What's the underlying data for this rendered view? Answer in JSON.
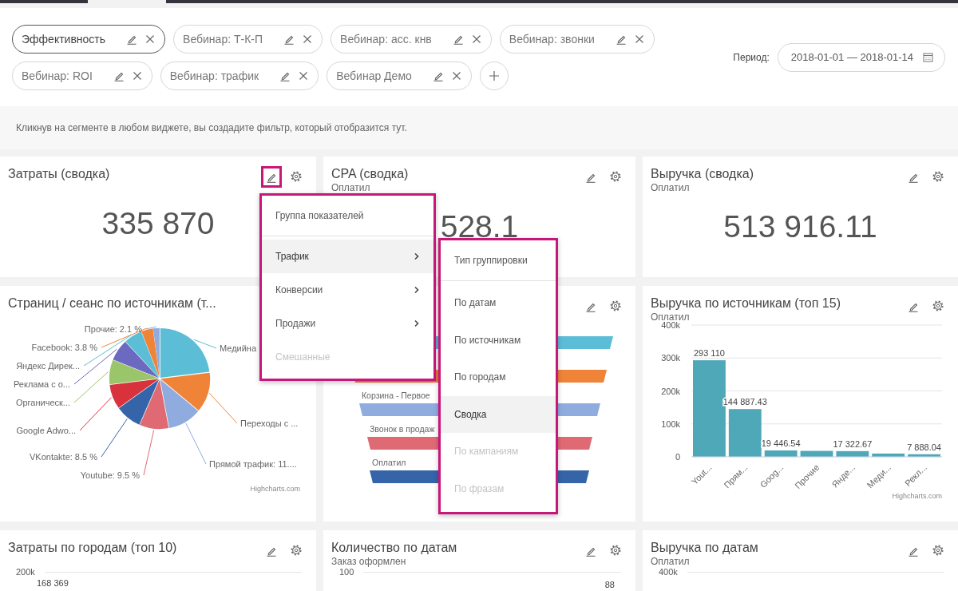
{
  "filters": {
    "chips": [
      {
        "label": "Эффективность",
        "selected": true
      },
      {
        "label": "Вебинар: Т-К-П",
        "selected": false
      },
      {
        "label": "Вебинар: асс. кнв",
        "selected": false
      },
      {
        "label": "Вебинар: звонки",
        "selected": false
      },
      {
        "label": "Вебинар: ROI",
        "selected": false
      },
      {
        "label": "Вебинар: трафик",
        "selected": false
      },
      {
        "label": "Вебинар Демо",
        "selected": false
      }
    ],
    "period_label": "Период:",
    "period_value": "2018-01-01 — 2018-01-14",
    "hint": "Кликнув на сегменте в любом виджете, вы создадите фильтр, который отобразится тут."
  },
  "widgets": [
    {
      "kind": "kpi",
      "title": "Затраты (сводка)",
      "value": "335 870",
      "edit_highlighted": true
    },
    {
      "kind": "kpi",
      "title": "CPA (сводка)",
      "subtitle": "Оплатил",
      "value": "528.1",
      "edit_highlighted": false
    },
    {
      "kind": "kpi",
      "title": "Выручка (сводка)",
      "subtitle": "Оплатил",
      "value": "513 916.11",
      "edit_highlighted": false
    },
    {
      "kind": "pie",
      "title": "Страниц / сеанс по источникам (т...",
      "credit": "Highcharts.com",
      "labels": [
        {
          "text": "Прочие: 2.1 %",
          "color": "#90acdf"
        },
        {
          "text": "Facebook: 3.8 %",
          "color": "#ef8439"
        },
        {
          "text": "Медийна",
          "color": "#5cbdd6"
        },
        {
          "text": "Яндекс Дирек...",
          "color": "#5cbdd6"
        },
        {
          "text": "Реклама с о...",
          "color": "#6b6ac0"
        },
        {
          "text": "Органическ...",
          "color": "#9bc56a"
        },
        {
          "text": "Переходы с ...",
          "color": "#ef8439"
        },
        {
          "text": "Google Adwo...",
          "color": "#d8323d"
        },
        {
          "text": "VKontakte: 8.5 %",
          "color": "#3565a8"
        },
        {
          "text": "Прямой трафик: 11....",
          "color": "#90acdf"
        },
        {
          "text": "Youtube: 9.5 %",
          "color": "#e06a74"
        }
      ]
    },
    {
      "kind": "funnel",
      "edit_highlighted": false,
      "stages": [
        {
          "color": "#5cbdd6"
        },
        {
          "color": "#ef8439"
        },
        {
          "label": "Корзина - Первое",
          "color": "#90acdf"
        },
        {
          "label": "Звонок в продаж",
          "color": "#e06a74"
        },
        {
          "label": "Оплатил",
          "color": "#3565a8"
        }
      ]
    },
    {
      "kind": "bar",
      "title": "Выручка по источникам (топ 15)",
      "subtitle": "Оплатил",
      "edit_highlighted": false,
      "credit": "Highcharts.com",
      "chart_data": {
        "type": "bar",
        "categories": [
          "Yout...",
          "Прям...",
          "Goog...",
          "Прочие",
          "Янде...",
          "Меди...",
          "Рекл..."
        ],
        "values": [
          293110,
          144887.43,
          19446.54,
          18000,
          17322.67,
          10000,
          7888.04
        ],
        "value_labels": [
          "293 110",
          "144 887.43",
          "19 446.54",
          null,
          "17 322.67",
          null,
          "7 888.04"
        ],
        "ylim": [
          0,
          400000
        ],
        "grid": true,
        "yticks": [
          {
            "value": 0,
            "label": "0"
          },
          {
            "value": 100000,
            "label": "100k"
          },
          {
            "value": 200000,
            "label": "200k"
          },
          {
            "value": 300000,
            "label": "300k"
          },
          {
            "value": 400000,
            "label": "400k"
          }
        ]
      }
    },
    {
      "kind": "partial-bar",
      "title": "Затраты по городам (топ 10)",
      "edit_highlighted": false,
      "tick": "200k",
      "value_label": "168 369"
    },
    {
      "kind": "partial-line",
      "title": "Количество по датам",
      "subtitle": "Заказ оформлен",
      "edit_highlighted": false,
      "tick": "100",
      "value_label": "88"
    },
    {
      "kind": "partial-line",
      "title": "Выручка по датам",
      "subtitle": "Оплатил",
      "edit_highlighted": false,
      "tick": "400k"
    }
  ],
  "menus": [
    {
      "items": [
        {
          "kind": "header",
          "label": "Группа показателей"
        },
        {
          "kind": "item",
          "label": "Трафик",
          "selected": true,
          "disabled": false,
          "submenu": true
        },
        {
          "kind": "item",
          "label": "Конверсии",
          "selected": false,
          "disabled": false,
          "submenu": true
        },
        {
          "kind": "item",
          "label": "Продажи",
          "selected": false,
          "disabled": false,
          "submenu": true
        },
        {
          "kind": "item",
          "label": "Смешанные",
          "selected": false,
          "disabled": true,
          "submenu": false
        }
      ]
    },
    {
      "items": [
        {
          "kind": "header",
          "label": "Тип группировки"
        },
        {
          "kind": "item",
          "label": "По датам",
          "selected": false,
          "disabled": false,
          "submenu": false
        },
        {
          "kind": "item",
          "label": "По источникам",
          "selected": false,
          "disabled": false,
          "submenu": false
        },
        {
          "kind": "item",
          "label": "По городам",
          "selected": false,
          "disabled": false,
          "submenu": false
        },
        {
          "kind": "item",
          "label": "Сводка",
          "selected": true,
          "disabled": false,
          "submenu": false
        },
        {
          "kind": "item",
          "label": "По кампаниям",
          "selected": false,
          "disabled": true,
          "submenu": false
        },
        {
          "kind": "item",
          "label": "По фразам",
          "selected": false,
          "disabled": true,
          "submenu": false
        }
      ]
    }
  ]
}
